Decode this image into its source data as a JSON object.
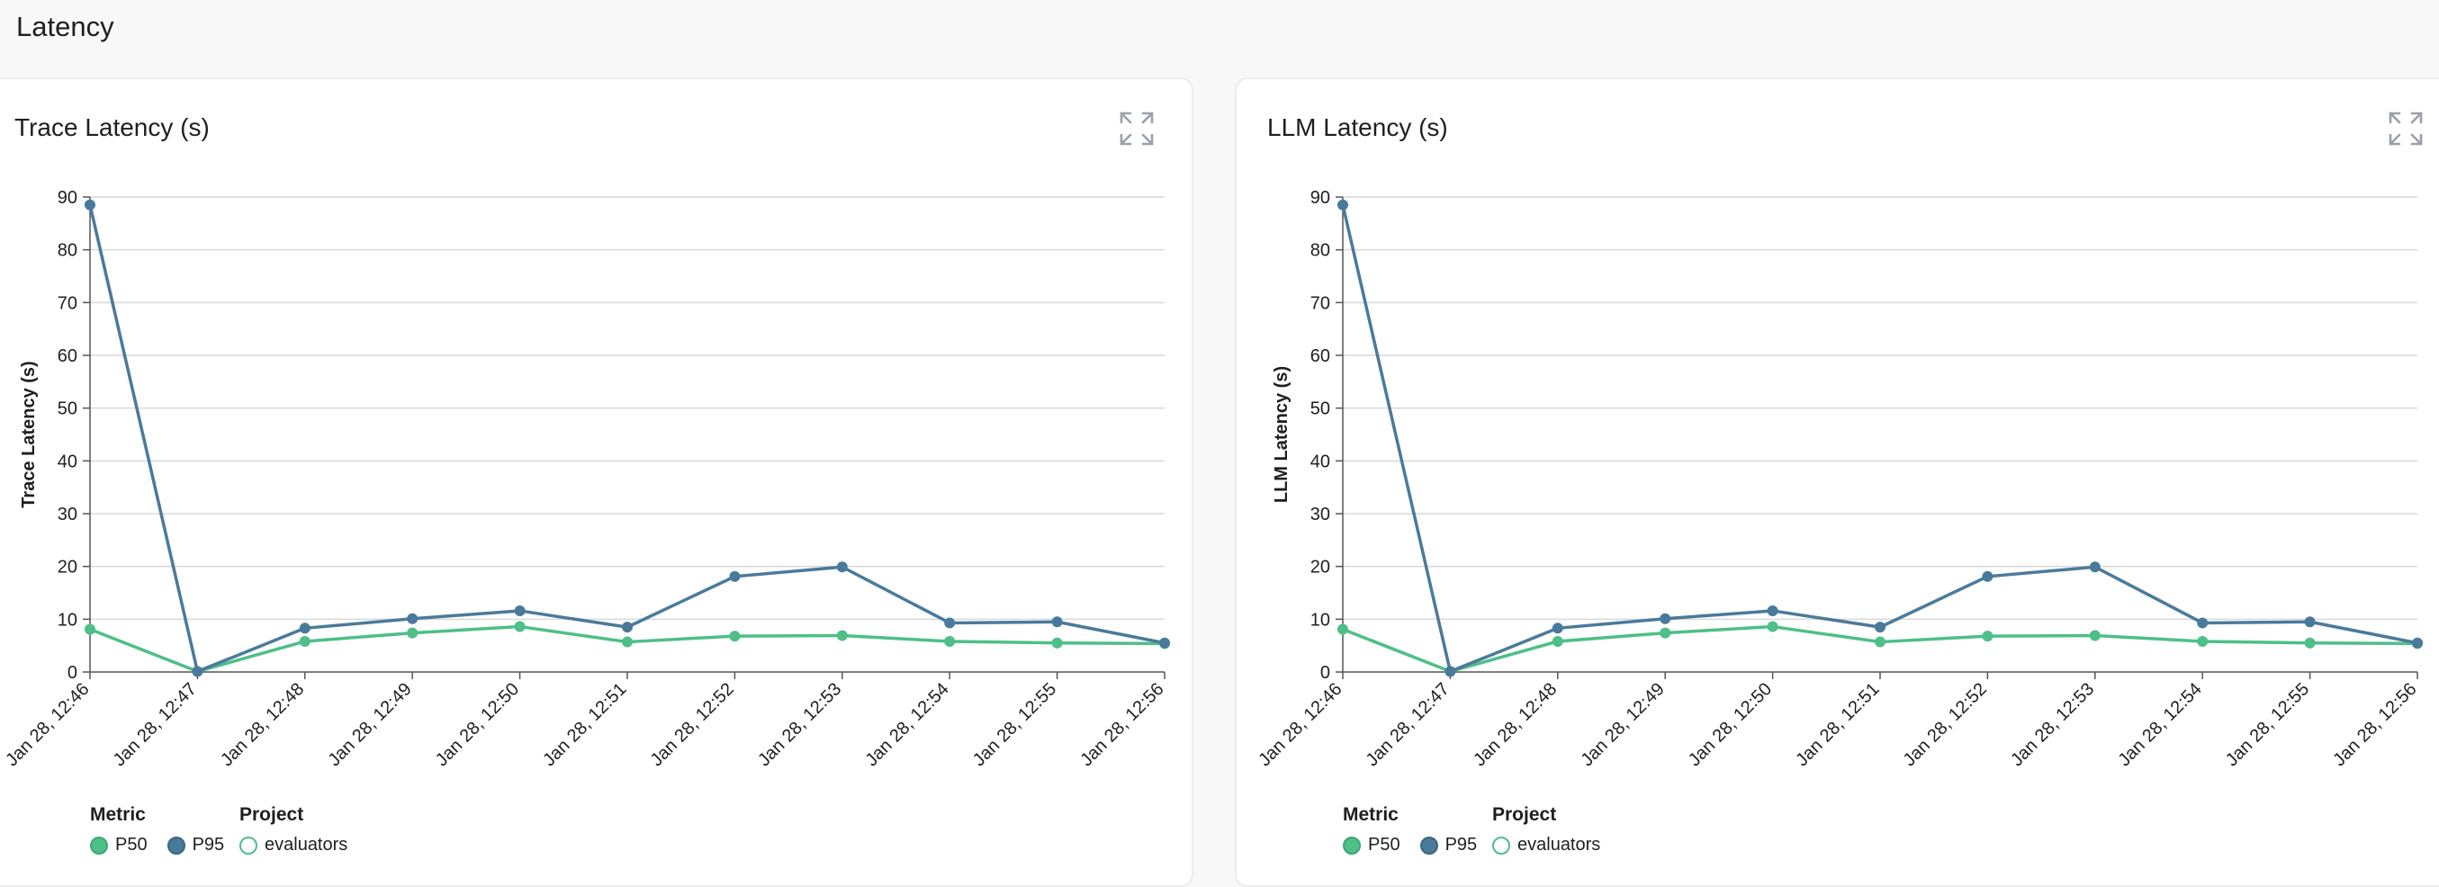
{
  "page": {
    "title": "Latency"
  },
  "colors": {
    "p50": "#4dbf87",
    "p95": "#4a7a9b",
    "grid": "#d9d9d9",
    "axis": "#555555",
    "text": "#1f1f1f",
    "icon": "#9aa0a6"
  },
  "cards": [
    {
      "title": "Trace Latency (s)",
      "expand_icon": "expand-icon",
      "legend": {
        "metric_title": "Metric",
        "metric_items": [
          "P50",
          "P95"
        ],
        "project_title": "Project",
        "project_items": [
          "evaluators"
        ]
      }
    },
    {
      "title": "LLM Latency (s)",
      "expand_icon": "expand-icon",
      "legend": {
        "metric_title": "Metric",
        "metric_items": [
          "P50",
          "P95"
        ],
        "project_title": "Project",
        "project_items": [
          "evaluators"
        ]
      }
    }
  ],
  "chart_data": [
    {
      "type": "line",
      "title": "Trace Latency (s)",
      "xlabel": "",
      "ylabel": "Trace Latency (s)",
      "ylim": [
        0,
        90
      ],
      "yticks": [
        0,
        10,
        20,
        30,
        40,
        50,
        60,
        70,
        80,
        90
      ],
      "grid": true,
      "legend_placement": "bottom-left",
      "categories": [
        "Jan 28, 12:46",
        "Jan 28, 12:47",
        "Jan 28, 12:48",
        "Jan 28, 12:49",
        "Jan 28, 12:50",
        "Jan 28, 12:51",
        "Jan 28, 12:52",
        "Jan 28, 12:53",
        "Jan 28, 12:54",
        "Jan 28, 12:55",
        "Jan 28, 12:56"
      ],
      "series": [
        {
          "name": "P50",
          "color": "#4dbf87",
          "values": [
            8.1,
            0.1,
            5.8,
            7.4,
            8.6,
            5.7,
            6.8,
            6.9,
            5.8,
            5.5,
            5.4
          ]
        },
        {
          "name": "P95",
          "color": "#4a7a9b",
          "values": [
            88.5,
            0.1,
            8.3,
            10.1,
            11.6,
            8.5,
            18.1,
            19.9,
            9.3,
            9.5,
            5.5
          ]
        }
      ]
    },
    {
      "type": "line",
      "title": "LLM Latency (s)",
      "xlabel": "",
      "ylabel": "LLM Latency (s)",
      "ylim": [
        0,
        90
      ],
      "yticks": [
        0,
        10,
        20,
        30,
        40,
        50,
        60,
        70,
        80,
        90
      ],
      "grid": true,
      "legend_placement": "bottom-left",
      "categories": [
        "Jan 28, 12:46",
        "Jan 28, 12:47",
        "Jan 28, 12:48",
        "Jan 28, 12:49",
        "Jan 28, 12:50",
        "Jan 28, 12:51",
        "Jan 28, 12:52",
        "Jan 28, 12:53",
        "Jan 28, 12:54",
        "Jan 28, 12:55",
        "Jan 28, 12:56"
      ],
      "series": [
        {
          "name": "P50",
          "color": "#4dbf87",
          "values": [
            8.1,
            0.1,
            5.8,
            7.4,
            8.6,
            5.7,
            6.8,
            6.9,
            5.8,
            5.5,
            5.4
          ]
        },
        {
          "name": "P95",
          "color": "#4a7a9b",
          "values": [
            88.5,
            0.1,
            8.3,
            10.1,
            11.6,
            8.5,
            18.1,
            19.9,
            9.3,
            9.5,
            5.5
          ]
        }
      ]
    }
  ]
}
